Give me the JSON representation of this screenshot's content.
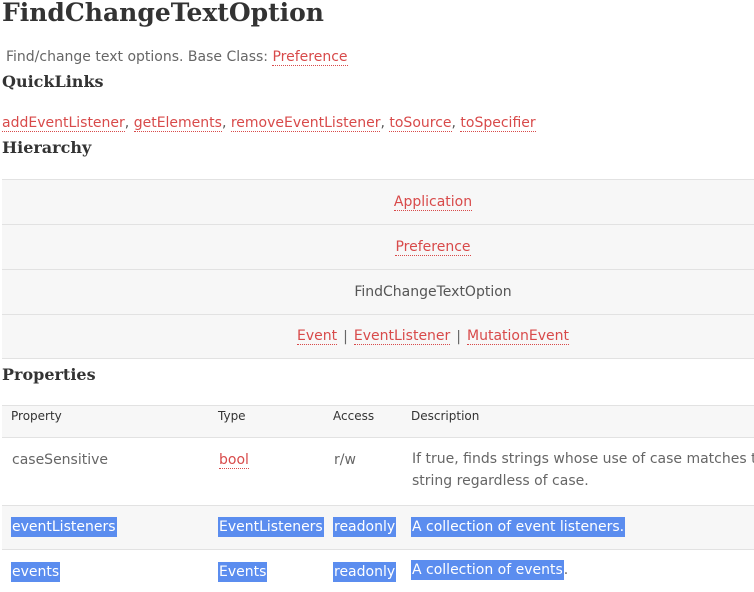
{
  "page": {
    "title": "FindChangeTextOption",
    "description_prefix": "Find/change text options. Base Class:",
    "base_class": "Preference"
  },
  "quicklinks": {
    "heading": "QuickLinks",
    "links": [
      "addEventListener",
      "getElements",
      "removeEventListener",
      "toSource",
      "toSpecifier"
    ],
    "separator": ","
  },
  "hierarchy": {
    "heading": "Hierarchy",
    "rows": {
      "r0": "Application",
      "r1": "Preference",
      "r2": "FindChangeTextOption",
      "r3": [
        "Event",
        "EventListener",
        "MutationEvent"
      ]
    },
    "separator": "|"
  },
  "properties": {
    "heading": "Properties",
    "columns": [
      "Property",
      "Type",
      "Access",
      "Description"
    ],
    "rows": [
      {
        "property": "caseSensitive",
        "type": "bool",
        "access": "r/w",
        "description_line1": "If true, finds strings whose use of case matches the fi",
        "description_line2": "string regardless of case."
      },
      {
        "property": "eventListeners",
        "type": "EventListeners",
        "access": "readonly",
        "description": "A collection of event listeners."
      },
      {
        "property": "events",
        "type": "Events",
        "access": "readonly",
        "description_selected": "A collection of events",
        "description_rest": "."
      }
    ]
  },
  "colors": {
    "link": "#d84a4a",
    "selection": "#5b8def",
    "row_alt": "#f7f7f7"
  }
}
